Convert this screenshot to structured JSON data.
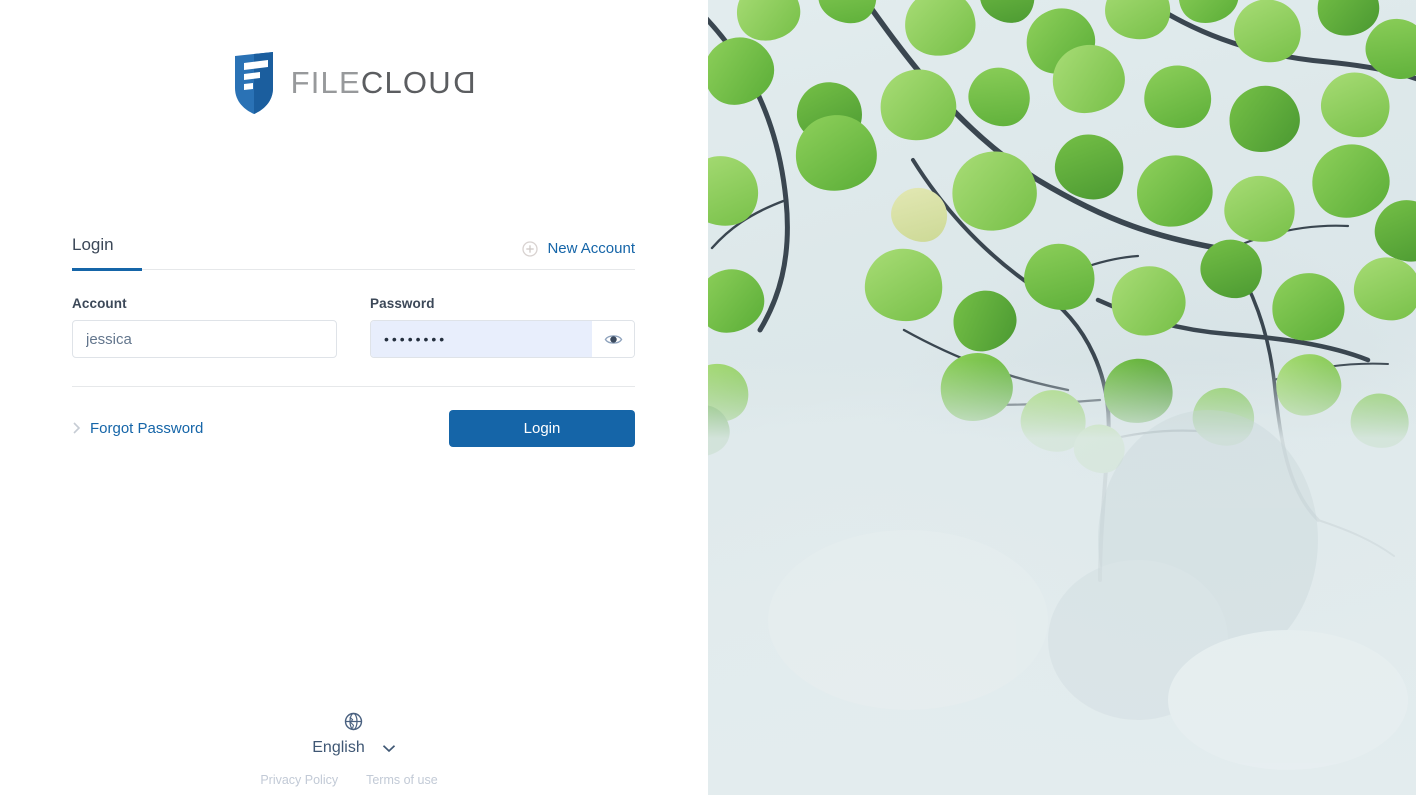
{
  "brand": {
    "logo_icon": "filecloud-shield-logo",
    "name_part1": "FILE",
    "name_part2": "CLOU",
    "name_part3": "D",
    "shield_color": "#2a72b5",
    "shield_dark": "#1b5e9e",
    "wordmark_light": "#97999b",
    "wordmark_dark": "#5b5d60"
  },
  "tabs": {
    "login_label": "Login",
    "active_color": "#1565a8"
  },
  "new_account": {
    "icon": "plus-circle-icon",
    "label": "New Account"
  },
  "form": {
    "account": {
      "label": "Account",
      "value": "jessica",
      "placeholder": "Account"
    },
    "password": {
      "label": "Password",
      "value": "••••••••",
      "placeholder": "Password",
      "toggle_icon": "eye-icon",
      "autofill_background": "#e8eefc"
    }
  },
  "actions": {
    "forgot_icon": "chevron-right-icon",
    "forgot_label": "Forgot Password",
    "login_button_label": "Login",
    "login_button_color": "#1565a8"
  },
  "footer": {
    "globe_icon": "globe-icon",
    "language": "English",
    "chevron_icon": "chevron-down-icon",
    "privacy_label": "Privacy Policy",
    "terms_label": "Terms of use"
  },
  "hero": {
    "image_alt": "green-leaves-photo",
    "sky_color": "#dfe9eb",
    "leaf_color": "#79c14a",
    "branch_color": "#2f3b44"
  }
}
